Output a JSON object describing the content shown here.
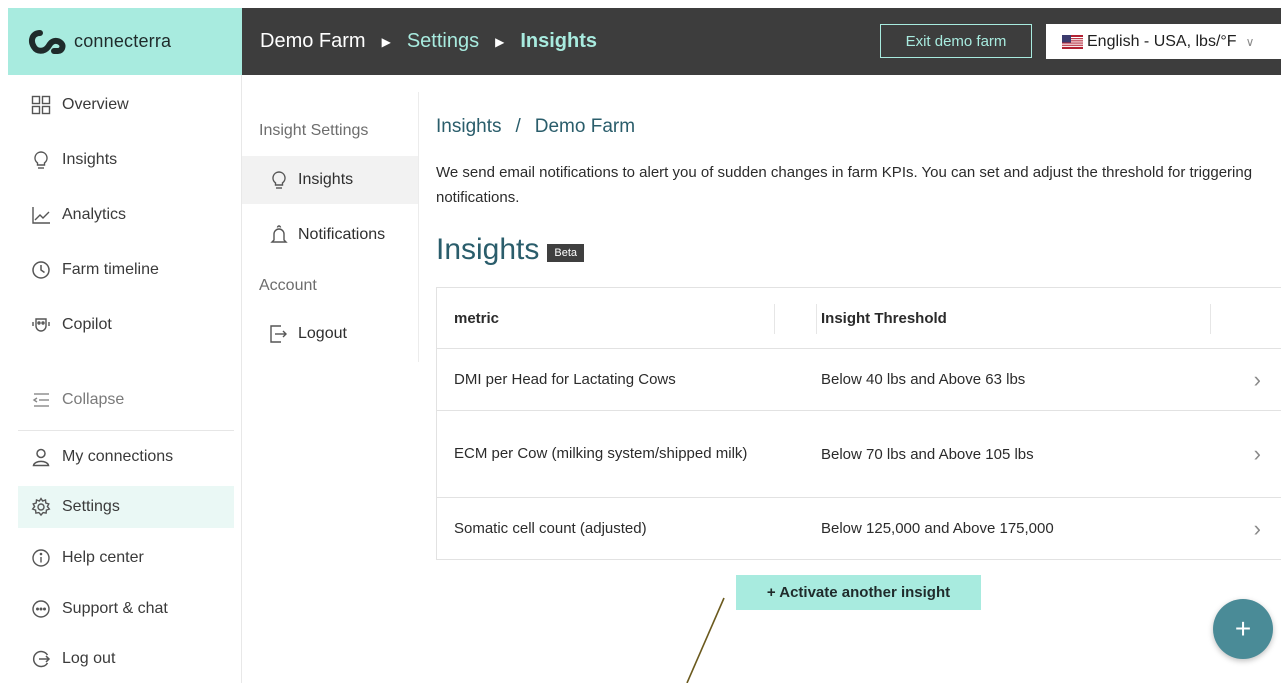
{
  "brand": {
    "name": "connecterra"
  },
  "header": {
    "breadcrumb": [
      {
        "label": "Demo Farm",
        "style": "plain"
      },
      {
        "label": "Settings",
        "style": "link"
      },
      {
        "label": "Insights",
        "style": "current"
      }
    ],
    "exit_label": "Exit demo farm",
    "language": {
      "selected": "English - USA, lbs/°F",
      "flag": "us-flag-icon"
    }
  },
  "sidebar": {
    "items": [
      {
        "label": "Overview",
        "icon": "grid-icon"
      },
      {
        "label": "Insights",
        "icon": "lightbulb-icon"
      },
      {
        "label": "Analytics",
        "icon": "chart-line-icon"
      },
      {
        "label": "Farm timeline",
        "icon": "clock-icon"
      },
      {
        "label": "Copilot",
        "icon": "copilot-icon"
      }
    ],
    "collapse_label": "Collapse",
    "bottom_items": [
      {
        "label": "My connections",
        "icon": "user-icon"
      },
      {
        "label": "Settings",
        "icon": "gear-icon",
        "active": true
      },
      {
        "label": "Help center",
        "icon": "info-icon"
      },
      {
        "label": "Support & chat",
        "icon": "chat-icon"
      },
      {
        "label": "Log out",
        "icon": "logout-icon"
      }
    ]
  },
  "subnav": {
    "insight_heading": "Insight Settings",
    "insights_label": "Insights",
    "notifications_label": "Notifications",
    "account_heading": "Account",
    "logout_label": "Logout"
  },
  "main": {
    "breadcrumb": [
      "Insights",
      "/",
      "Demo Farm"
    ],
    "description": "We send email notifications to alert you of sudden changes in farm KPIs. You can set and adjust the threshold for triggering notifications.",
    "title": "Insights",
    "badge": "Beta",
    "table": {
      "headers": [
        "metric",
        "Insight Threshold"
      ],
      "rows": [
        {
          "metric": "DMI per Head for Lactating Cows",
          "threshold": "Below 40 lbs and Above 63 lbs"
        },
        {
          "metric": "ECM per Cow (milking system/shipped milk)",
          "threshold": "Below 70 lbs and Above 105 lbs"
        },
        {
          "metric": "Somatic cell count (adjusted)",
          "threshold": "Below 125,000 and Above 175,000"
        }
      ]
    },
    "activate_label": "+ Activate another insight",
    "fab_label": "+"
  },
  "colors": {
    "accent": "#a8ebdf",
    "topbar": "#3d3d3d",
    "teal_text": "#2a5d6b",
    "fab": "#4a8b97"
  }
}
